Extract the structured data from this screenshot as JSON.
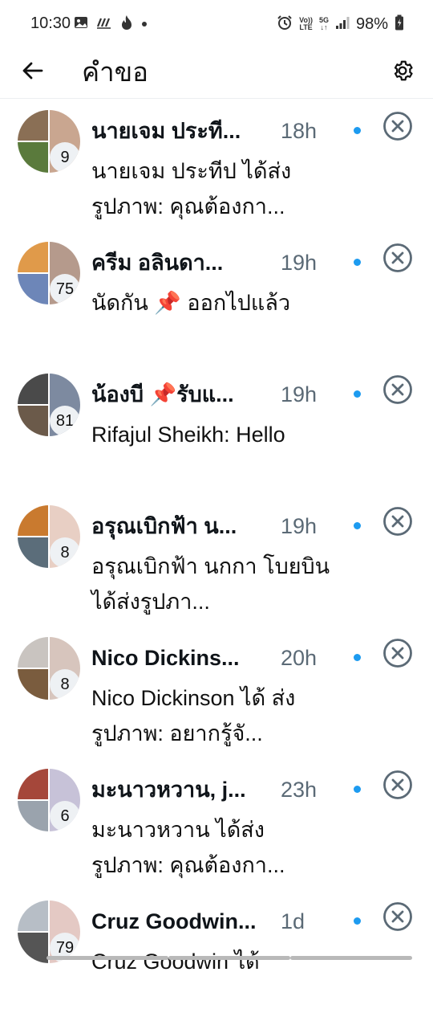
{
  "status_bar": {
    "time": "10:30",
    "battery_percent": "98%",
    "network_volte_line1": "Vo))",
    "network_volte_line2": "LTE",
    "network_5g": "5G",
    "left_icons": [
      "image-icon",
      "signal-wave-icon",
      "tinder-flame-icon",
      "dot-icon"
    ],
    "right_icons": [
      "alarm-icon",
      "signal-bars-icon",
      "battery-charging-icon"
    ]
  },
  "header": {
    "title": "คำขอ",
    "back_icon": "arrow-left-icon",
    "settings_icon": "gear-icon"
  },
  "requests": [
    {
      "name": "นายเจม ประที...",
      "time": "18h",
      "count": "9",
      "preview": "นายเจม ประทีป ได้ส่ง รูปภาพ: คุณต้องกา...",
      "unread": true,
      "avatar_colors": [
        "#8a6f55",
        "#5a7a3c",
        "#c9a690"
      ]
    },
    {
      "name": "ครีม อลินดา...",
      "time": "19h",
      "count": "75",
      "preview": "นัดกัน 📌 ออกไปแล้ว",
      "unread": true,
      "avatar_colors": [
        "#e09a4a",
        "#6d86b8",
        "#b59a8c"
      ]
    },
    {
      "name": "น้องบี 📌รับแ...",
      "time": "19h",
      "count": "81",
      "preview": "Rifajul Sheikh: Hello",
      "unread": true,
      "avatar_colors": [
        "#4a4a4a",
        "#6b5a4a",
        "#7d8aa0"
      ]
    },
    {
      "name": "อรุณเบิกฟ้า น...",
      "time": "19h",
      "count": "8",
      "preview": "อรุณเบิกฟ้า นกกา โบยบิน ได้ส่งรูปภา...",
      "unread": true,
      "avatar_colors": [
        "#c97a2f",
        "#5b6d7a",
        "#e8cfc4"
      ]
    },
    {
      "name": "Nico Dickins...",
      "time": "20h",
      "count": "8",
      "preview": "Nico Dickinson ได้ ส่งรูปภาพ: อยากรู้จั...",
      "unread": true,
      "avatar_colors": [
        "#c9c4c0",
        "#7a5c3e",
        "#d7c5bd"
      ]
    },
    {
      "name": "มะนาวหวาน, j...",
      "time": "23h",
      "count": "6",
      "preview": "มะนาวหวาน ได้ส่ง รูปภาพ: คุณต้องกา...",
      "unread": true,
      "avatar_colors": [
        "#a5473a",
        "#9aa3ad",
        "#c7c2d8"
      ]
    },
    {
      "name": "Cruz Goodwin...",
      "time": "1d",
      "count": "79",
      "preview": "Cruz Goodwin ได้",
      "unread": true,
      "avatar_colors": [
        "#b7bec6",
        "#555555",
        "#e4c9c4"
      ]
    }
  ],
  "dismiss_icon": "close-circle-icon"
}
